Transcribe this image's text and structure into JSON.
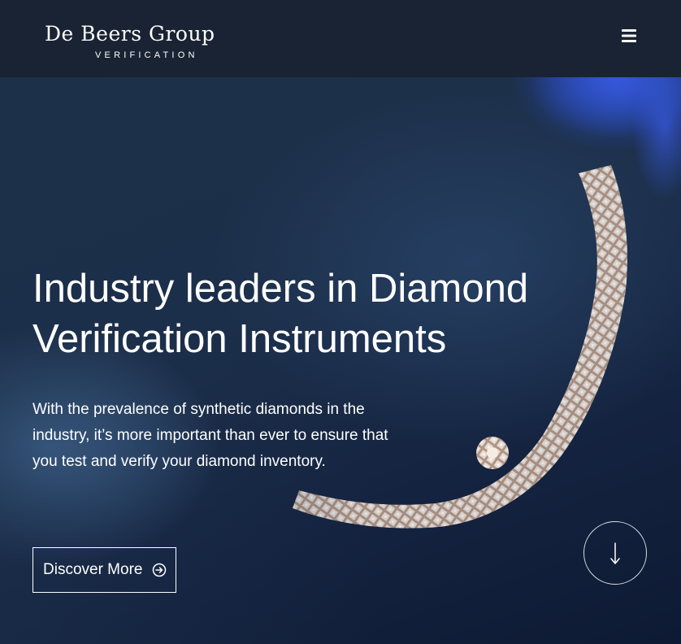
{
  "header": {
    "logo": {
      "name": "De Beers Group",
      "subtitle": "VERIFICATION"
    },
    "menu_icon": "hamburger-menu-icon"
  },
  "hero": {
    "title": "Industry leaders in Diamond Verification Instruments",
    "text": "With the prevalence of synthetic diamonds in the industry, it’s more important than ever to ensure that you test and verify your diamond inventory.",
    "cta": {
      "label": "Discover More",
      "icon": "arrow-right-circle-icon"
    },
    "scroll_icon": "arrow-down-icon"
  },
  "colors": {
    "header_bg": "#192333",
    "hero_bg": "#1c2f4a",
    "text": "#ffffff",
    "glove_accent": "#264ac4"
  }
}
